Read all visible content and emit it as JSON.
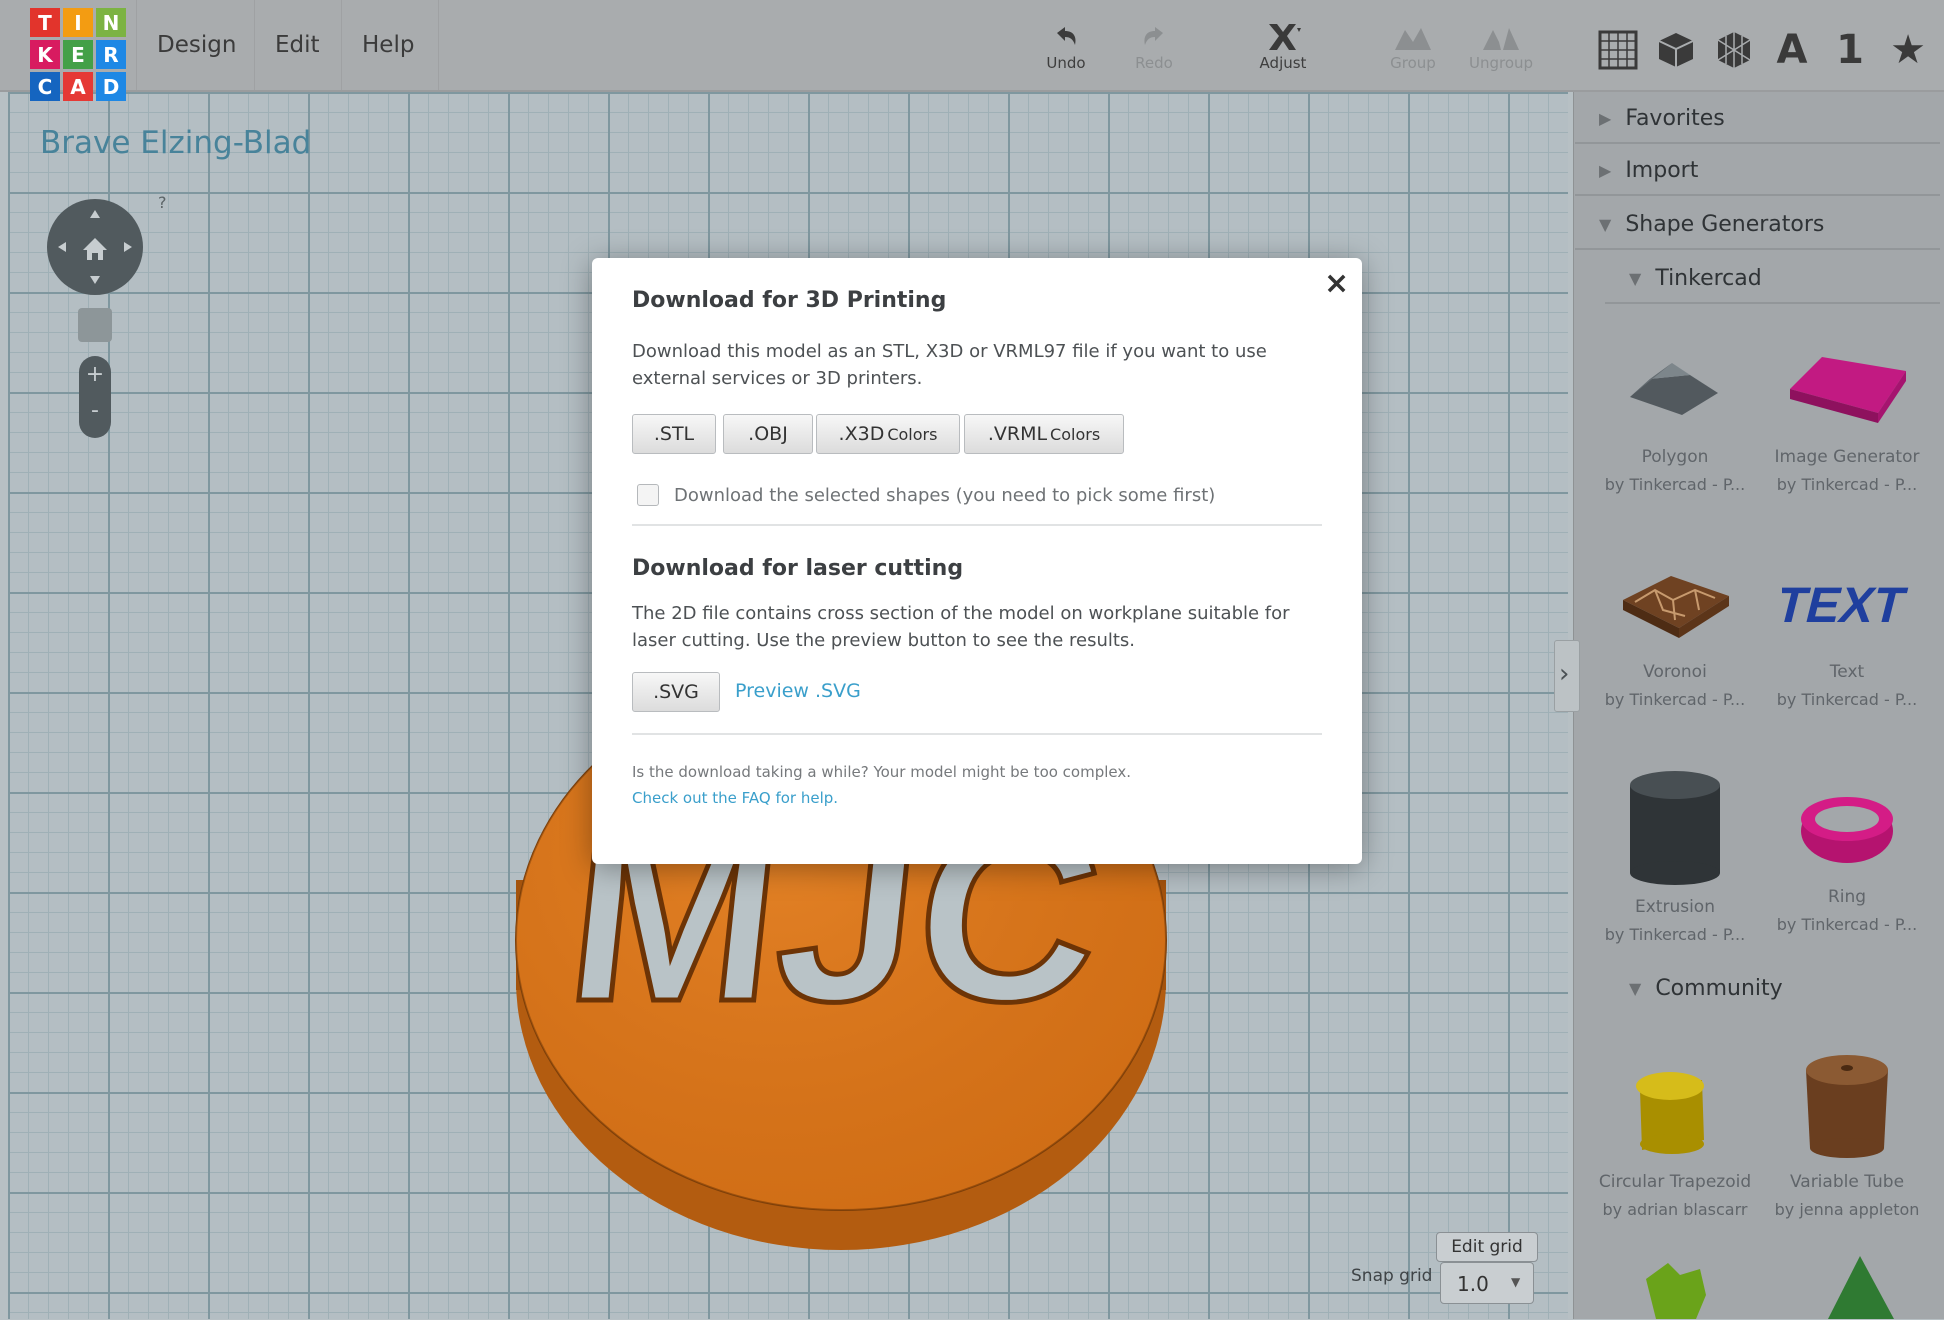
{
  "app": {
    "logo_letters": [
      "T",
      "I",
      "N",
      "K",
      "E",
      "R",
      "C",
      "A",
      "D"
    ],
    "logo_colors": [
      "#e2342c",
      "#f39c12",
      "#7cb342",
      "#d81b60",
      "#43a047",
      "#1e88e5",
      "#1565c0",
      "#e53935",
      "#1e88e5"
    ]
  },
  "menu": {
    "design": "Design",
    "edit": "Edit",
    "help": "Help"
  },
  "toolbar": {
    "undo": "Undo",
    "redo": "Redo",
    "adjust": "Adjust",
    "group": "Group",
    "ungroup": "Ungroup"
  },
  "design_title": "Brave Elzing-Blad",
  "view_help": "?",
  "snap": {
    "edit_grid": "Edit grid",
    "label": "Snap grid",
    "value": "1.0"
  },
  "sidebar": {
    "icons": [
      "grid-icon",
      "cube-icon",
      "sphere-icon",
      "letter-a-icon",
      "number-one-icon",
      "star-icon"
    ],
    "letter_a": "A",
    "number_one": "1",
    "favorites": "Favorites",
    "import": "Import",
    "shape_generators": "Shape Generators",
    "tinkercad": "Tinkercad",
    "community": "Community",
    "shapes": [
      {
        "name": "Polygon",
        "by": "by Tinkercad - P..."
      },
      {
        "name": "Image Generator",
        "by": "by Tinkercad - P..."
      },
      {
        "name": "Voronoi",
        "by": "by Tinkercad - P..."
      },
      {
        "name": "Text",
        "by": "by Tinkercad - P..."
      },
      {
        "name": "Extrusion",
        "by": "by Tinkercad - P..."
      },
      {
        "name": "Ring",
        "by": "by Tinkercad - P..."
      }
    ],
    "community_shapes": [
      {
        "name": "Circular Trapezoid",
        "by": "by adrian blascarr"
      },
      {
        "name": "Variable Tube",
        "by": "by jenna appleton"
      }
    ],
    "text_shape_label": "TEXT"
  },
  "model_text": "MJC",
  "modal": {
    "title_3d": "Download for 3D Printing",
    "desc_3d": "Download this model as an STL, X3D or VRML97 file if you want to use external services or 3D printers.",
    "buttons": [
      {
        "label": ".STL",
        "sub": ""
      },
      {
        "label": ".OBJ",
        "sub": ""
      },
      {
        "label": ".X3D",
        "sub": "Colors"
      },
      {
        "label": ".VRML",
        "sub": "Colors"
      }
    ],
    "selected_only_label": "Download the selected shapes (you need to pick some first)",
    "title_laser": "Download for laser cutting",
    "desc_laser": "The 2D file contains cross section of the model on workplane suitable for laser cutting. Use the preview button to see the results.",
    "svg_button": ".SVG",
    "preview_link": "Preview .SVG",
    "footer_note": "Is the download taking a while? Your model might be too complex.",
    "faq_link": "Check out the FAQ for help.",
    "close": "×"
  }
}
